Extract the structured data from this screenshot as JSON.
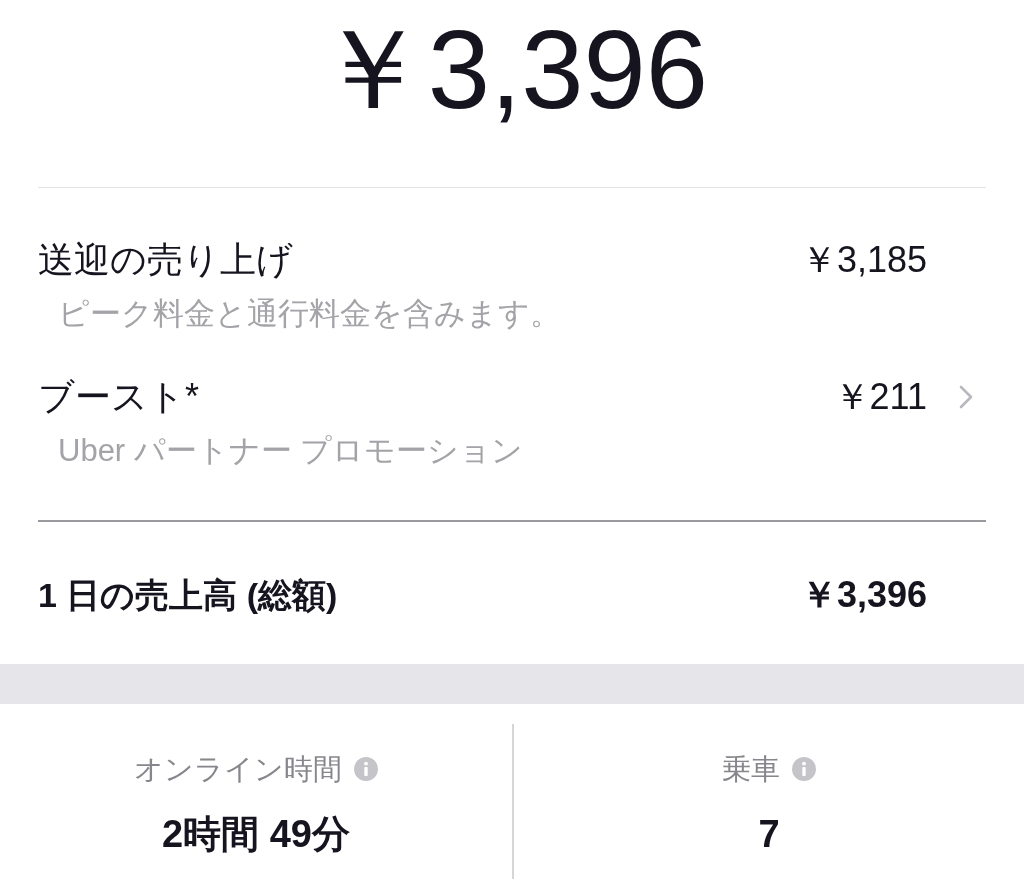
{
  "total_earnings": "￥3,396",
  "breakdown": [
    {
      "label": "送迎の売り上げ",
      "note": "ピーク料金と通行料金を含みます。",
      "amount": "￥3,185",
      "has_detail": false
    },
    {
      "label": "ブースト*",
      "note": "Uber パートナー プロモーション",
      "amount": "￥211",
      "has_detail": true
    }
  ],
  "daily_total": {
    "label": "1 日の売上高 (総額)",
    "amount": "￥3,396"
  },
  "stats": [
    {
      "label": "オンライン時間",
      "value": "2時間 49分"
    },
    {
      "label": "乗車",
      "value": "7"
    }
  ]
}
